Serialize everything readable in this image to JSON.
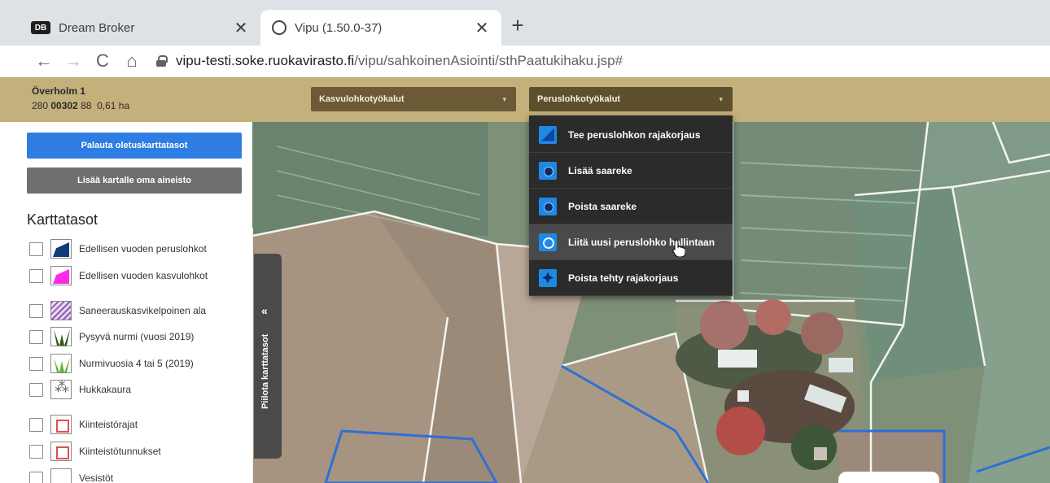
{
  "browser": {
    "tabs": [
      {
        "title": "Dream Broker",
        "favicon": "DB",
        "close": "✕"
      },
      {
        "title": "Vipu (1.50.0-37)",
        "favicon": "globe",
        "close": "✕"
      }
    ],
    "new_tab": "+",
    "nav": {
      "back": "←",
      "forward": "→",
      "reload": "C",
      "home": "⌂"
    },
    "url_domain": "vipu-testi.soke.ruokavirasto.fi",
    "url_path": "/vipu/sahkoinenAsiointi/sthPaatukihaku.jsp#"
  },
  "header": {
    "parcel_name": "Överholm 1",
    "parcel_id_prefix": "280 ",
    "parcel_id_bold": "00302",
    "parcel_id_suffix": " 88",
    "parcel_area": "0,61 ha",
    "kasvulohko_tools": "Kasvulohkotyökalut",
    "peruslohko_tools": "Peruslohkotyökalut",
    "chevron": "▾"
  },
  "menu": {
    "items": [
      {
        "label": "Tee peruslohkon rajakorjaus",
        "icon": "boundary-edit-icon"
      },
      {
        "label": "Lisää saareke",
        "icon": "add-island-icon"
      },
      {
        "label": "Poista saareke",
        "icon": "remove-island-icon"
      },
      {
        "label": "Liitä uusi peruslohko hallintaan",
        "icon": "join-parcel-icon"
      },
      {
        "label": "Poista tehty rajakorjaus",
        "icon": "undo-correction-icon"
      }
    ]
  },
  "sidebar": {
    "reset_button": "Palauta oletuskarttatasot",
    "add_button": "Lisää kartalle oma aineisto",
    "layers_title": "Karttatasot",
    "layers": [
      {
        "label": "Edellisen vuoden peruslohkot",
        "swatch": "blue-parcel"
      },
      {
        "label": "Edellisen vuoden kasvulohkot",
        "swatch": "magenta-parcel"
      },
      {
        "label": "Saneerauskasvikelpoinen ala",
        "swatch": "purple-hatch"
      },
      {
        "label": "Pysyvä nurmi (vuosi 2019)",
        "swatch": "dark-grass"
      },
      {
        "label": "Nurmivuosia 4 tai 5 (2019)",
        "swatch": "light-grass"
      },
      {
        "label": "Hukkakaura",
        "swatch": "wild-oat"
      },
      {
        "label": "Kiinteistörajat",
        "swatch": "property-grid"
      },
      {
        "label": "Kiinteistötunnukset",
        "swatch": "property-grid"
      },
      {
        "label": "Vesistöt",
        "swatch": "water"
      }
    ]
  },
  "hide_layers_tab": {
    "label": "Piilota karttatasot",
    "chevron": "«"
  },
  "colors": {
    "header_bg": "#c4b07b",
    "dropdown_bg": "#6b5a35",
    "menu_bg": "#2b2b2b",
    "primary_button": "#2e7de2",
    "secondary_button": "#6f6f6f",
    "parcel_outline": "#2f6fd6"
  }
}
